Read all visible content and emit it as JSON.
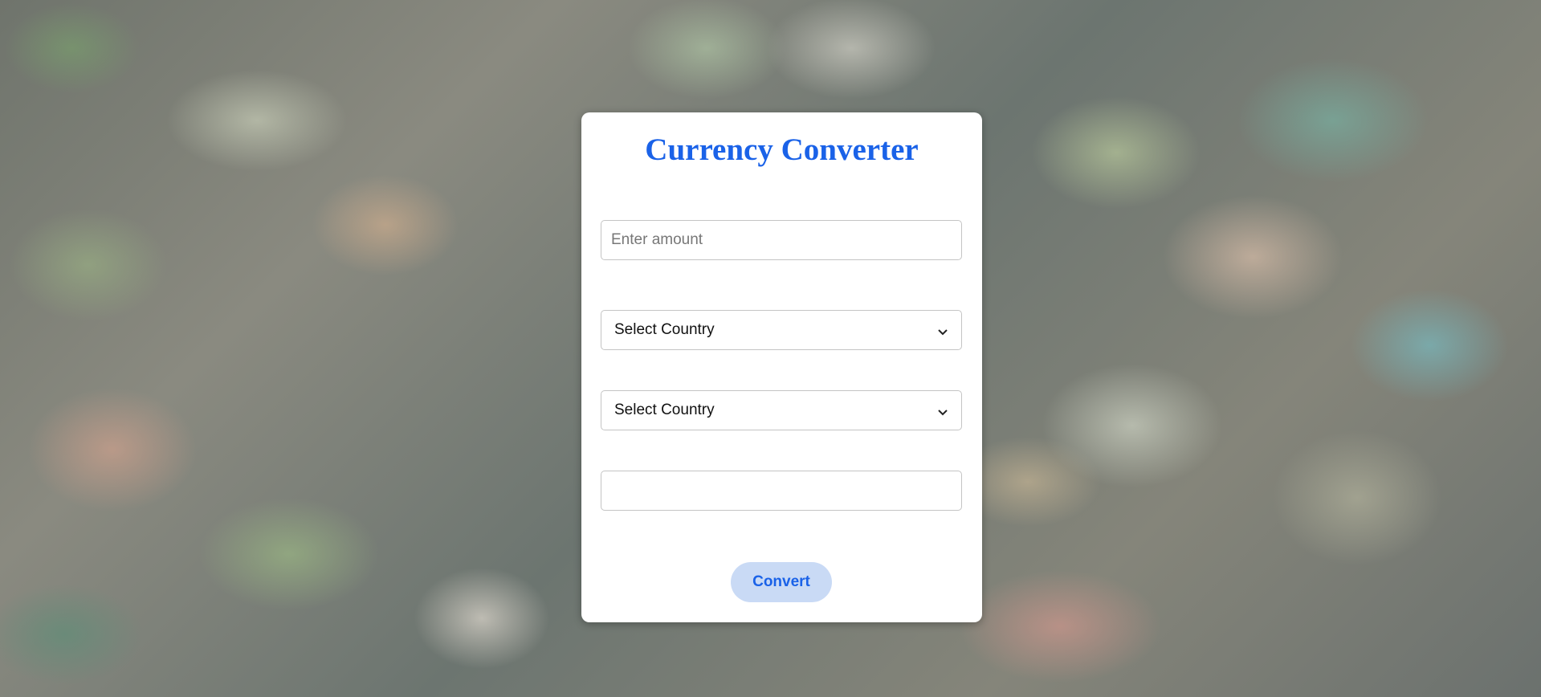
{
  "app": {
    "title": "Currency Converter"
  },
  "form": {
    "amount_placeholder": "Enter amount",
    "amount_value": "",
    "from_select_value": "Select Country",
    "to_select_value": "Select Country",
    "result_value": "",
    "convert_label": "Convert"
  },
  "colors": {
    "accent": "#1a62e8",
    "button_bg": "#c9daf5",
    "card_bg": "#ffffff"
  },
  "icons": {
    "select_arrow": "chevron-down-icon"
  }
}
